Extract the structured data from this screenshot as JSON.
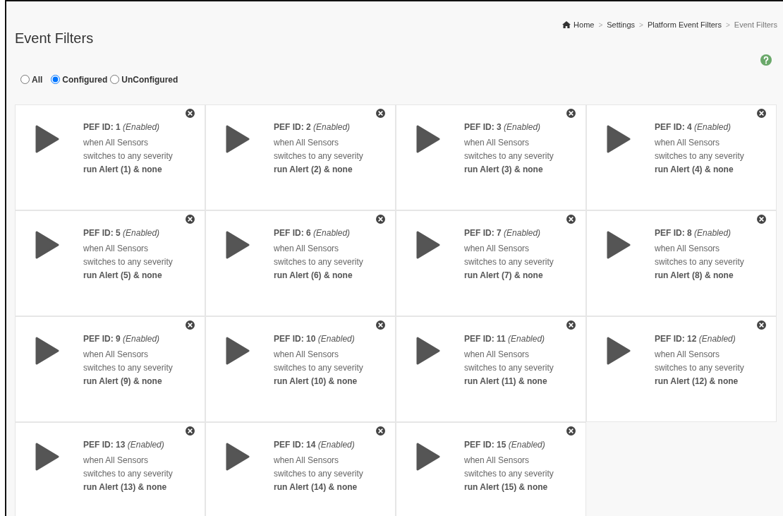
{
  "page_title": "Event Filters",
  "breadcrumb": [
    {
      "label": "Home",
      "kind": "home"
    },
    {
      "separator": ">",
      "label": "Settings",
      "kind": "link"
    },
    {
      "separator": ">",
      "label": "Platform Event Filters",
      "kind": "link"
    },
    {
      "separator": ">",
      "label": "Event Filters",
      "kind": "current"
    }
  ],
  "filter_options": [
    {
      "label": "All",
      "selected": false
    },
    {
      "label": "Configured",
      "selected": true
    },
    {
      "label": "UnConfigured",
      "selected": false
    }
  ],
  "filters": [
    {
      "id": "PEF ID: 1",
      "status": "(Enabled)",
      "condition": "when All Sensors",
      "severity": "switches to any severity",
      "action": "run Alert (1) & none"
    },
    {
      "id": "PEF ID: 2",
      "status": "(Enabled)",
      "condition": "when All Sensors",
      "severity": "switches to any severity",
      "action": "run Alert (2) & none"
    },
    {
      "id": "PEF ID: 3",
      "status": "(Enabled)",
      "condition": "when All Sensors",
      "severity": "switches to any severity",
      "action": "run Alert (3) & none"
    },
    {
      "id": "PEF ID: 4",
      "status": "(Enabled)",
      "condition": "when All Sensors",
      "severity": "switches to any severity",
      "action": "run Alert (4) & none"
    },
    {
      "id": "PEF ID: 5",
      "status": "(Enabled)",
      "condition": "when All Sensors",
      "severity": "switches to any severity",
      "action": "run Alert (5) & none"
    },
    {
      "id": "PEF ID: 6",
      "status": "(Enabled)",
      "condition": "when All Sensors",
      "severity": "switches to any severity",
      "action": "run Alert (6) & none"
    },
    {
      "id": "PEF ID: 7",
      "status": "(Enabled)",
      "condition": "when All Sensors",
      "severity": "switches to any severity",
      "action": "run Alert (7) & none"
    },
    {
      "id": "PEF ID: 8",
      "status": "(Enabled)",
      "condition": "when All Sensors",
      "severity": "switches to any severity",
      "action": "run Alert (8) & none"
    },
    {
      "id": "PEF ID: 9",
      "status": "(Enabled)",
      "condition": "when All Sensors",
      "severity": "switches to any severity",
      "action": "run Alert (9) & none"
    },
    {
      "id": "PEF ID: 10",
      "status": "(Enabled)",
      "condition": "when All Sensors",
      "severity": "switches to any severity",
      "action": "run Alert (10) & none"
    },
    {
      "id": "PEF ID: 11",
      "status": "(Enabled)",
      "condition": "when All Sensors",
      "severity": "switches to any severity",
      "action": "run Alert (11) & none"
    },
    {
      "id": "PEF ID: 12",
      "status": "(Enabled)",
      "condition": "when All Sensors",
      "severity": "switches to any severity",
      "action": "run Alert (12) & none"
    },
    {
      "id": "PEF ID: 13",
      "status": "(Enabled)",
      "condition": "when All Sensors",
      "severity": "switches to any severity",
      "action": "run Alert (13) & none"
    },
    {
      "id": "PEF ID: 14",
      "status": "(Enabled)",
      "condition": "when All Sensors",
      "severity": "switches to any severity",
      "action": "run Alert (14) & none"
    },
    {
      "id": "PEF ID: 15",
      "status": "(Enabled)",
      "condition": "when All Sensors",
      "severity": "switches to any severity",
      "action": "run Alert (15) & none"
    }
  ]
}
